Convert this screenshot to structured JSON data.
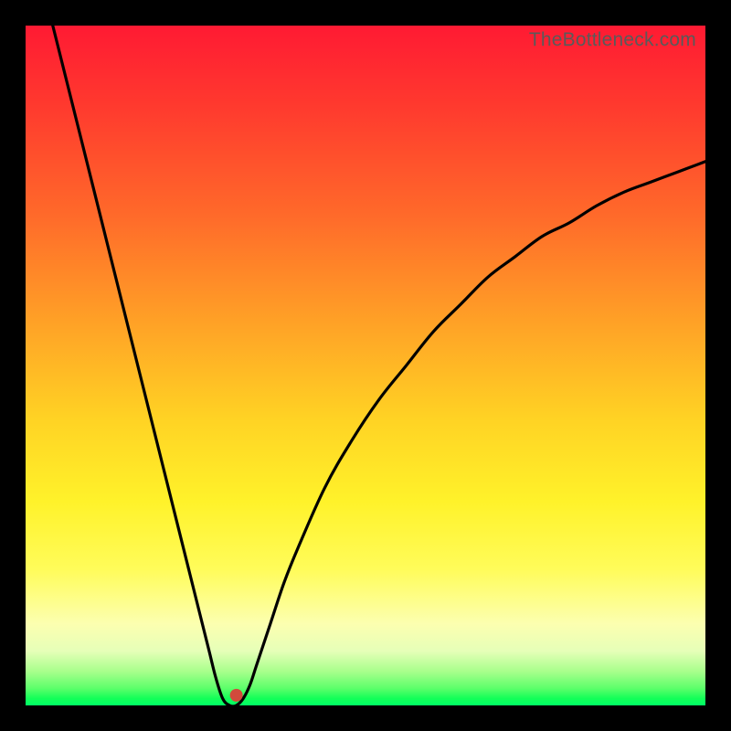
{
  "watermark": "TheBottleneck.com",
  "chart_data": {
    "type": "line",
    "title": "",
    "xlabel": "",
    "ylabel": "",
    "xlim": [
      0,
      100
    ],
    "ylim": [
      0,
      100
    ],
    "background_gradient_stops": [
      {
        "pos": 0,
        "color": "#ff1a33"
      },
      {
        "pos": 28,
        "color": "#ff6a2a"
      },
      {
        "pos": 58,
        "color": "#ffd324"
      },
      {
        "pos": 80,
        "color": "#fffc5a"
      },
      {
        "pos": 95,
        "color": "#a8ff8c"
      },
      {
        "pos": 100,
        "color": "#00ff66"
      }
    ],
    "series": [
      {
        "name": "bottleneck-curve",
        "color": "#000000",
        "x": [
          4,
          6,
          8,
          10,
          12,
          14,
          16,
          18,
          20,
          22,
          24,
          26,
          27,
          28,
          29,
          30,
          31,
          32,
          33,
          34,
          36,
          38,
          40,
          44,
          48,
          52,
          56,
          60,
          64,
          68,
          72,
          76,
          80,
          84,
          88,
          92,
          96,
          100
        ],
        "y": [
          100,
          92,
          84,
          76,
          68,
          60,
          52,
          44,
          36,
          28,
          20,
          12,
          8,
          4,
          1,
          0,
          0,
          1,
          3,
          6,
          12,
          18,
          23,
          32,
          39,
          45,
          50,
          55,
          59,
          63,
          66,
          69,
          71,
          73.5,
          75.5,
          77,
          78.5,
          80
        ]
      }
    ],
    "marker": {
      "name": "optimal-point",
      "x": 31,
      "y": 1.5,
      "color": "#d24a3c",
      "radius_px": 7
    }
  }
}
